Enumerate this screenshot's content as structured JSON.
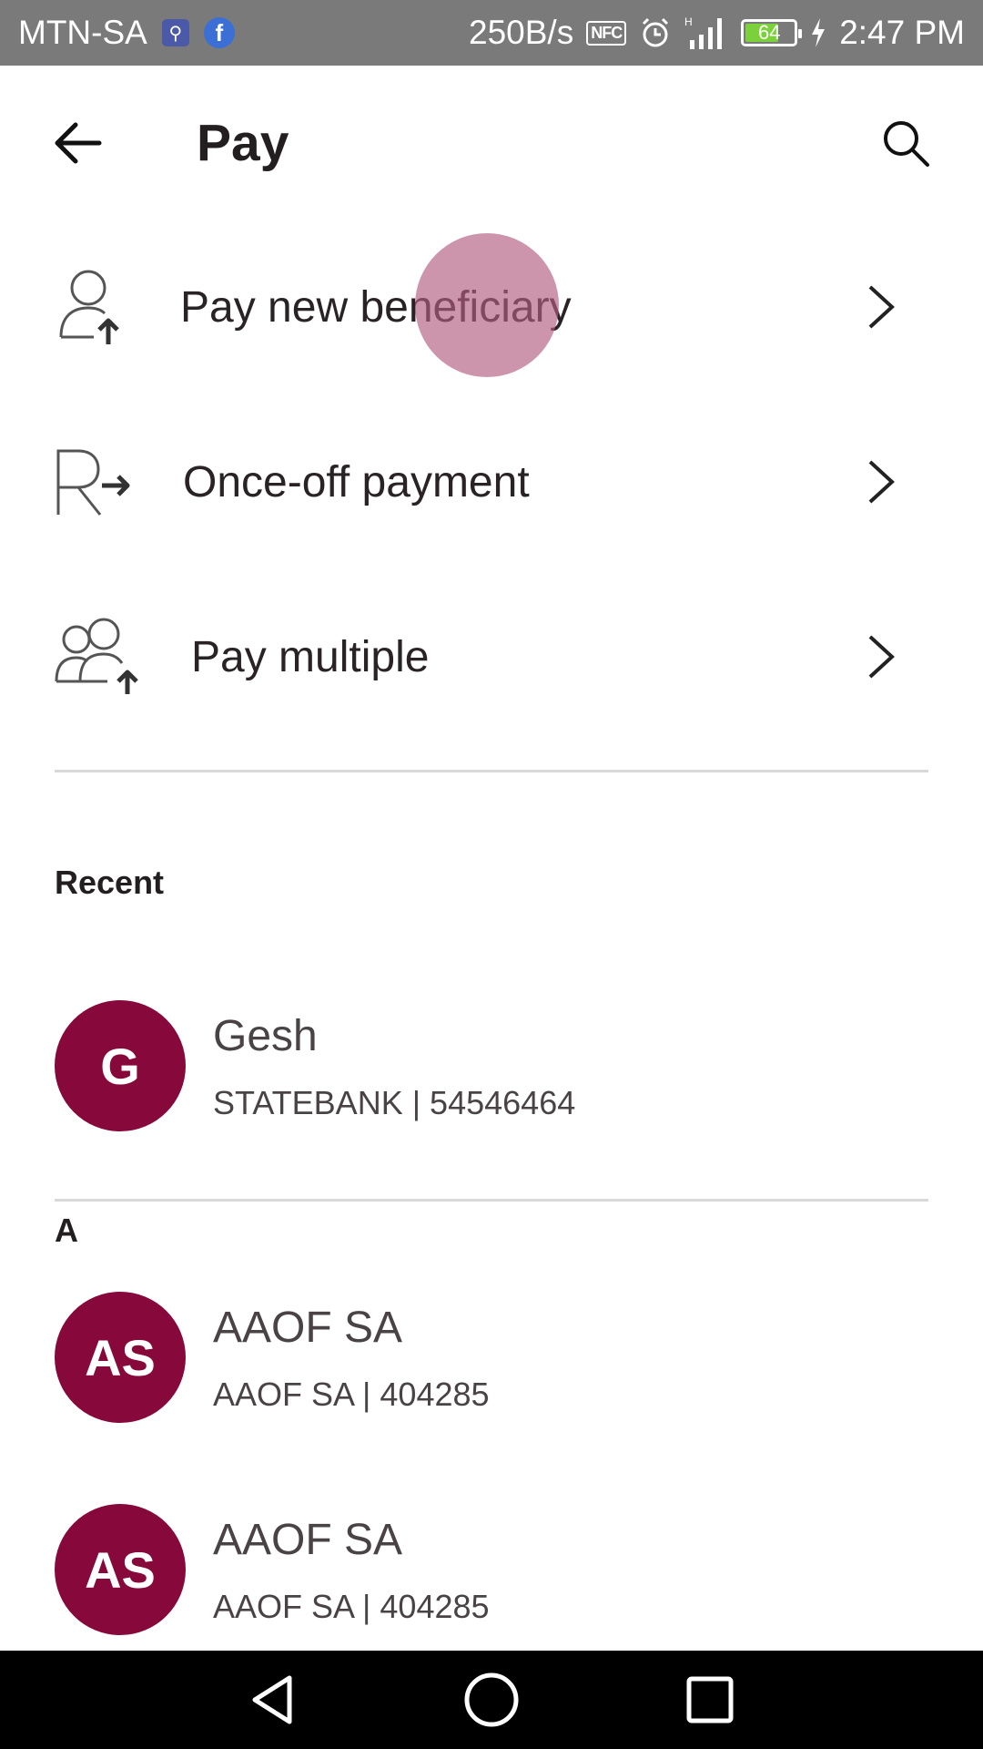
{
  "status_bar": {
    "carrier": "MTN-SA",
    "net_speed": "250B/s",
    "nfc_label": "NFC",
    "network_type": "H",
    "battery_level": "64",
    "time": "2:47 PM"
  },
  "header": {
    "title": "Pay"
  },
  "menu": [
    {
      "label": "Pay new beneficiary",
      "icon": "person-upload-icon"
    },
    {
      "label": "Once-off payment",
      "icon": "rand-arrow-icon"
    },
    {
      "label": "Pay multiple",
      "icon": "group-upload-icon"
    }
  ],
  "recent": {
    "heading": "Recent",
    "items": [
      {
        "initials": "G",
        "name": "Gesh",
        "detail": "STATEBANK | 54546464"
      }
    ]
  },
  "section_a": {
    "heading": "A",
    "items": [
      {
        "initials": "AS",
        "name": "AAOF SA",
        "detail": "AAOF SA | 404285"
      },
      {
        "initials": "AS",
        "name": "AAOF SA",
        "detail": "AAOF SA | 404285"
      }
    ]
  },
  "colors": {
    "accent": "#87093c",
    "status_bar": "#7a7a7a",
    "divider": "#d9d9d9",
    "ripple": "#c48aa5"
  }
}
